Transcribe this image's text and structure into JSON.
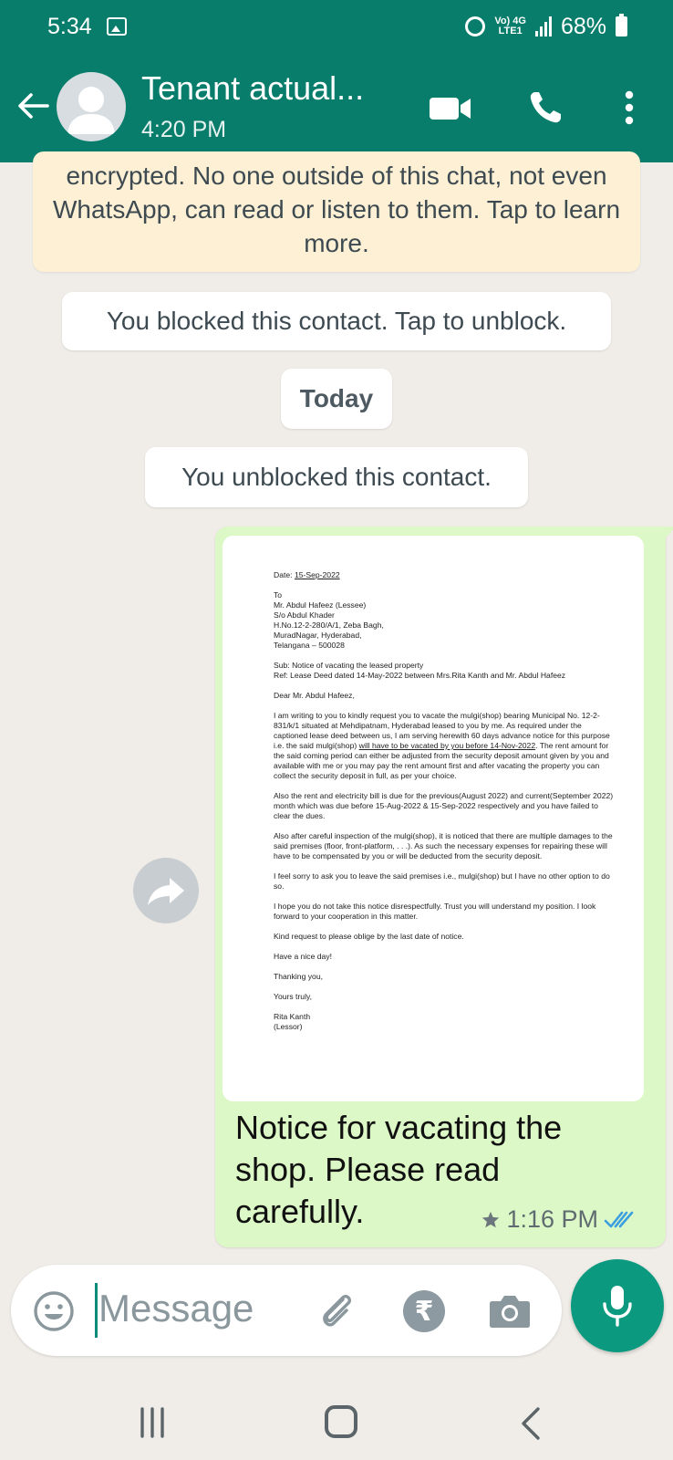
{
  "status_bar": {
    "time": "5:34",
    "network_top": "Vo) 4G",
    "network_bottom": "LTE1",
    "battery": "68%"
  },
  "header": {
    "contact_name": "Tenant actual...",
    "subtitle": "4:20 PM"
  },
  "chat": {
    "encryption_note": "encrypted. No one outside of this chat, not even WhatsApp, can read or listen to them. Tap to learn more.",
    "blocked_notice": "You blocked this contact. Tap to unblock.",
    "date_divider": "Today",
    "unblocked_notice": "You unblocked this contact."
  },
  "message": {
    "document": {
      "date_label": "Date:",
      "date": "15-Sep-2022",
      "address": [
        "To",
        "Mr. Abdul Hafeez (Lessee)",
        "S/o Abdul Khader",
        "H.No.12-2-280/A/1, Zeba Bagh,",
        "MuradNagar, Hyderabad,",
        "Telangana – 500028"
      ],
      "subject": "Sub: Notice of vacating the leased property",
      "reference": "Ref: Lease Deed dated 14-May-2022 between Mrs.Rita Kanth and Mr. Abdul Hafeez",
      "salutation": "Dear Mr. Abdul Hafeez,",
      "para1_a": "I am writing to you to kindly request you to vacate the mulgi(shop) bearing Municipal No. 12-2-831/k/1 situated at Mehdipatnam, Hyderabad leased to you by me. As required under the captioned lease deed between us, I am serving herewith 60 days advance notice for this purpose i.e. the said mulgi(shop)",
      "para1_u": "will have to be vacated by you before 14-Nov-2022",
      "para1_b": ". The rent amount for the said coming period can either be adjusted from the security deposit amount given by you and available with me or you may pay the rent amount first and after vacating the property you can collect the security deposit in full, as per your choice.",
      "para2": "Also the rent and electricity bill is due for the previous(August 2022) and current(September 2022) month which was due before 15-Aug-2022 & 15-Sep-2022 respectively and you have failed to clear the dues.",
      "para3": "Also after careful inspection of the mulgi(shop), it is noticed that there are multiple damages to the said premises (floor, front-platform, . . .). As such the necessary expenses for repairing these will have to be compensated by you or will be deducted from the security deposit.",
      "para4": "I feel sorry to ask you to leave the said premises i.e., mulgi(shop) but I have no other option to do so.",
      "para5": "I hope you do not take this notice disrespectfully. Trust you will understand my position. I look forward to your cooperation in this matter.",
      "para6": "Kind request to please oblige by the last date of notice.",
      "para7": "Have a nice day!",
      "closing1": "Thanking you,",
      "closing2": "Yours truly,",
      "signer_name": "Rita Kanth",
      "signer_role": "(Lessor)"
    },
    "caption": "Notice for vacating the shop. Please read carefully.",
    "time": "1:16 PM",
    "starred": true,
    "read": true
  },
  "composer": {
    "placeholder": "Message",
    "currency_symbol": "₹"
  },
  "colors": {
    "header": "#087d6b",
    "outgoing_bubble": "#dcf8c6",
    "encryption_note": "#fdf0d4",
    "mic_button": "#0b9a7f",
    "read_ticks": "#3a9ee0"
  }
}
